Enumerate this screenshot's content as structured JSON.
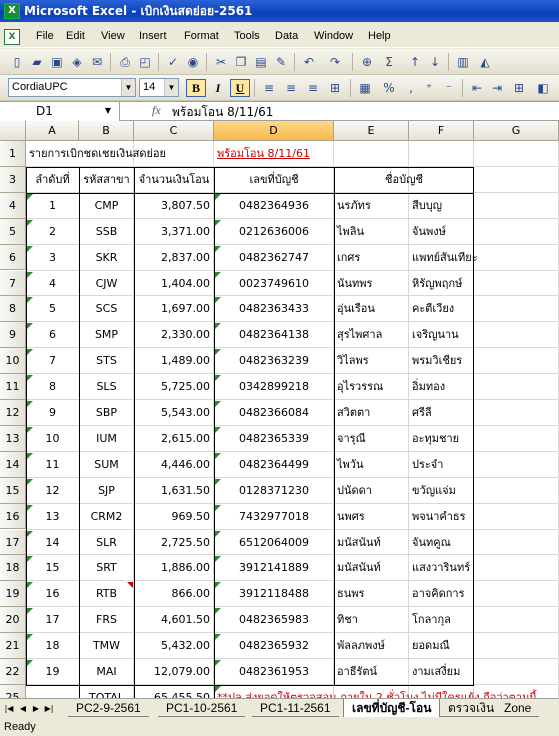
{
  "app": {
    "title": "Microsoft Excel - เบิกเงินสดย่อย-2561"
  },
  "menu": [
    "File",
    "Edit",
    "View",
    "Insert",
    "Format",
    "Tools",
    "Data",
    "Window",
    "Help"
  ],
  "font_toolbar": {
    "font_name": "CordiaUPC",
    "font_size": "14",
    "bold": "B",
    "italic": "I",
    "underline": "U",
    "percent": "%",
    "comma": ","
  },
  "name_box": "D1",
  "fx": "fx",
  "formula": "พร้อมโอน  8/11/61",
  "columns": [
    "A",
    "B",
    "C",
    "D",
    "E",
    "F",
    "G"
  ],
  "selected_column": "D",
  "sheet": {
    "title": "รายการเบิกชดเชยเงินสดย่อย",
    "ready_label": "พร้อมโอน  8/11/61",
    "headers": [
      "ลำดับที่",
      "รหัสสาขา",
      "จำนวนเงินโอน",
      "เลขที่บัญชี",
      "ชื่อบัญชี"
    ],
    "row_numbers": [
      "1",
      "3",
      "4",
      "5",
      "6",
      "7",
      "8",
      "9",
      "10",
      "11",
      "12",
      "13",
      "14",
      "15",
      "16",
      "17",
      "18",
      "19",
      "20",
      "21",
      "22",
      "25"
    ],
    "rows": [
      [
        "1",
        "CMP",
        "3,807.50",
        "0482364936",
        "นรภัทร",
        "สืบบุญ"
      ],
      [
        "2",
        "SSB",
        "3,371.00",
        "0212636006",
        "ไพลิน",
        "จันพงษ์"
      ],
      [
        "3",
        "SKR",
        "2,837.00",
        "0482362747",
        "เกศร",
        "แพทย์สันเทียะ"
      ],
      [
        "4",
        "CJW",
        "1,404.00",
        "0023749610",
        "นันทพร",
        "หิรัญพฤกษ์"
      ],
      [
        "5",
        "SCS",
        "1,697.00",
        "0482363433",
        "อุ่นเรือน",
        "คะตีเวียง"
      ],
      [
        "6",
        "SMP",
        "2,330.00",
        "0482364138",
        "สุรไพศาล",
        "เจริญนาน"
      ],
      [
        "7",
        "STS",
        "1,489.00",
        "0482363239",
        "วิไลพร",
        "พรมวิเชียร"
      ],
      [
        "8",
        "SLS",
        "5,725.00",
        "0342899218",
        "อุไรวรรณ",
        "อิ่มทอง"
      ],
      [
        "9",
        "SBP",
        "5,543.00",
        "0482366084",
        "สวิตตา",
        "ศรีลี"
      ],
      [
        "10",
        "IUM",
        "2,615.00",
        "0482365339",
        "จารุณี",
        "อะทุมชาย"
      ],
      [
        "11",
        "SUM",
        "4,446.00",
        "0482364499",
        "ไพวัน",
        "ประจำ"
      ],
      [
        "12",
        "SJP",
        "1,631.50",
        "0128371230",
        "ปนัดดา",
        "ขวัญแจ่ม"
      ],
      [
        "13",
        "CRM2",
        "969.50",
        "7432977018",
        "นพศร",
        "พจนาคำธร"
      ],
      [
        "14",
        "SLR",
        "2,725.50",
        "6512064009",
        "มนัสนันท์",
        "จันทคูณ"
      ],
      [
        "15",
        "SRT",
        "1,886.00",
        "3912141889",
        "มนัสนันท์",
        "แสงวารินทร์"
      ],
      [
        "16",
        "RTB",
        "866.00",
        "3912118488",
        "ธนพร",
        "อาจคิดการ"
      ],
      [
        "17",
        "FRS",
        "4,601.50",
        "0482365983",
        "ทิชา",
        "โกลากุล"
      ],
      [
        "18",
        "TMW",
        "5,432.00",
        "0482365932",
        "พัลลภพงษ์",
        "ยอดมณี"
      ],
      [
        "19",
        "MAI",
        "12,079.00",
        "0482361953",
        "อาธีรัตน์",
        "งามเสงี่ยม"
      ]
    ],
    "total_label": "TOTAL",
    "total_value": "65,455.50",
    "note": "**ปล.ส่งยอดให้ตรวจสอบ ภายใน 2 ชั่วโมง ไม่มีใครแย้ง ถือว่าตามนี้",
    "colors": {
      "red": "#cc0000",
      "green_triangle": "#2d8a2d",
      "selection": "#f6b94d"
    }
  },
  "tabs": [
    "PC2-9-2561",
    "PC1-10-2561",
    "PC1-11-2561",
    "เลขที่บัญชี-โอน",
    "ตรวจเงิน",
    "Zone"
  ],
  "active_tab": "เลขที่บัญชี-โอน",
  "status": "Ready"
}
